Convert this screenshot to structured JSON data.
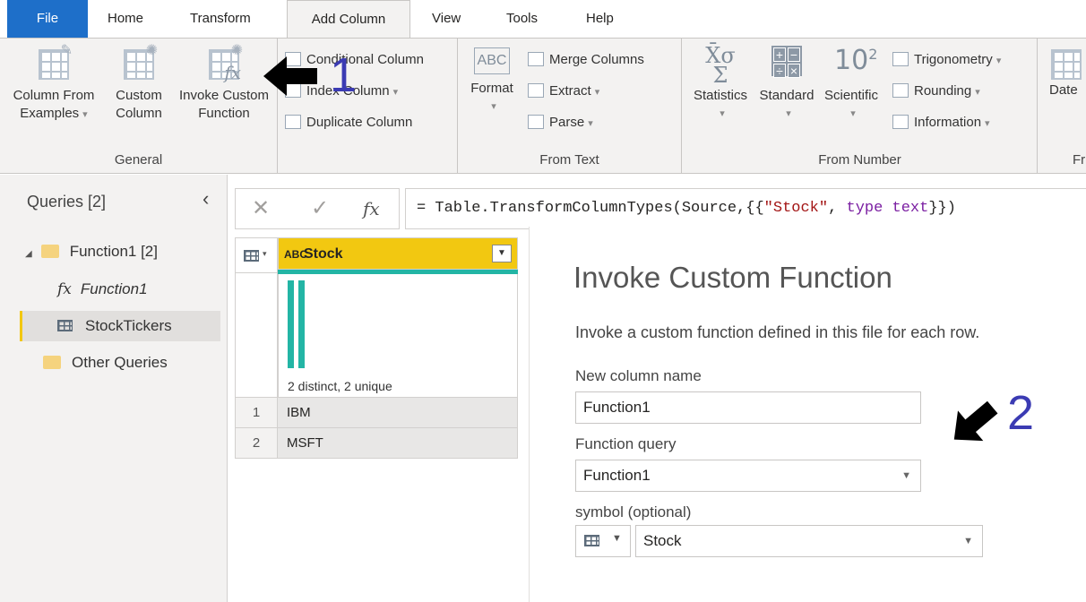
{
  "menu": {
    "tabs": [
      "File",
      "Home",
      "Transform",
      "Add Column",
      "View",
      "Tools",
      "Help"
    ],
    "active_tab": "Add Column"
  },
  "ribbon": {
    "general": {
      "label": "General",
      "column_from_examples": [
        "Column From",
        "Examples"
      ],
      "custom_column": [
        "Custom",
        "Column"
      ],
      "invoke_custom_function": [
        "Invoke Custom",
        "Function"
      ],
      "conditional_column": "Conditional Column",
      "index_column": "Index Column",
      "duplicate_column": "Duplicate Column"
    },
    "from_text": {
      "label": "From Text",
      "format": "Format",
      "merge_columns": "Merge Columns",
      "extract": "Extract",
      "parse": "Parse"
    },
    "from_number": {
      "label": "From Number",
      "statistics": "Statistics",
      "standard": "Standard",
      "scientific": "Scientific",
      "trigonometry": "Trigonometry",
      "rounding": "Rounding",
      "information": "Information"
    },
    "next_group": {
      "button": "Date",
      "label": "Fr"
    }
  },
  "queries": {
    "title": "Queries [2]",
    "items": [
      {
        "label": "Function1 [2]",
        "type": "group"
      },
      {
        "label": "Function1",
        "type": "function"
      },
      {
        "label": "StockTickers",
        "type": "table",
        "selected": true
      },
      {
        "label": "Other Queries",
        "type": "group"
      }
    ]
  },
  "formula": {
    "prefix": "= Table.TransformColumnTypes(Source,{{",
    "string": "\"Stock\"",
    "middle": ", ",
    "keyword": "type text",
    "suffix": "}})"
  },
  "grid": {
    "column_type": "ABC",
    "column_name": "Stock",
    "profile": "2 distinct, 2 unique",
    "rows": [
      {
        "num": "1",
        "value": "IBM"
      },
      {
        "num": "2",
        "value": "MSFT"
      }
    ]
  },
  "dialog": {
    "title": "Invoke Custom Function",
    "description": "Invoke a custom function defined in this file for each row.",
    "new_column_label": "New column name",
    "new_column_value": "Function1",
    "function_query_label": "Function query",
    "function_query_value": "Function1",
    "param_label": "symbol (optional)",
    "param_value": "Stock"
  },
  "annotations": {
    "one": "1",
    "two": "2"
  },
  "colors": {
    "file_tab": "#1e6fc9",
    "column_header": "#f2c811",
    "profile_bar": "#23b5a5",
    "annotation": "#3b3bb3"
  }
}
